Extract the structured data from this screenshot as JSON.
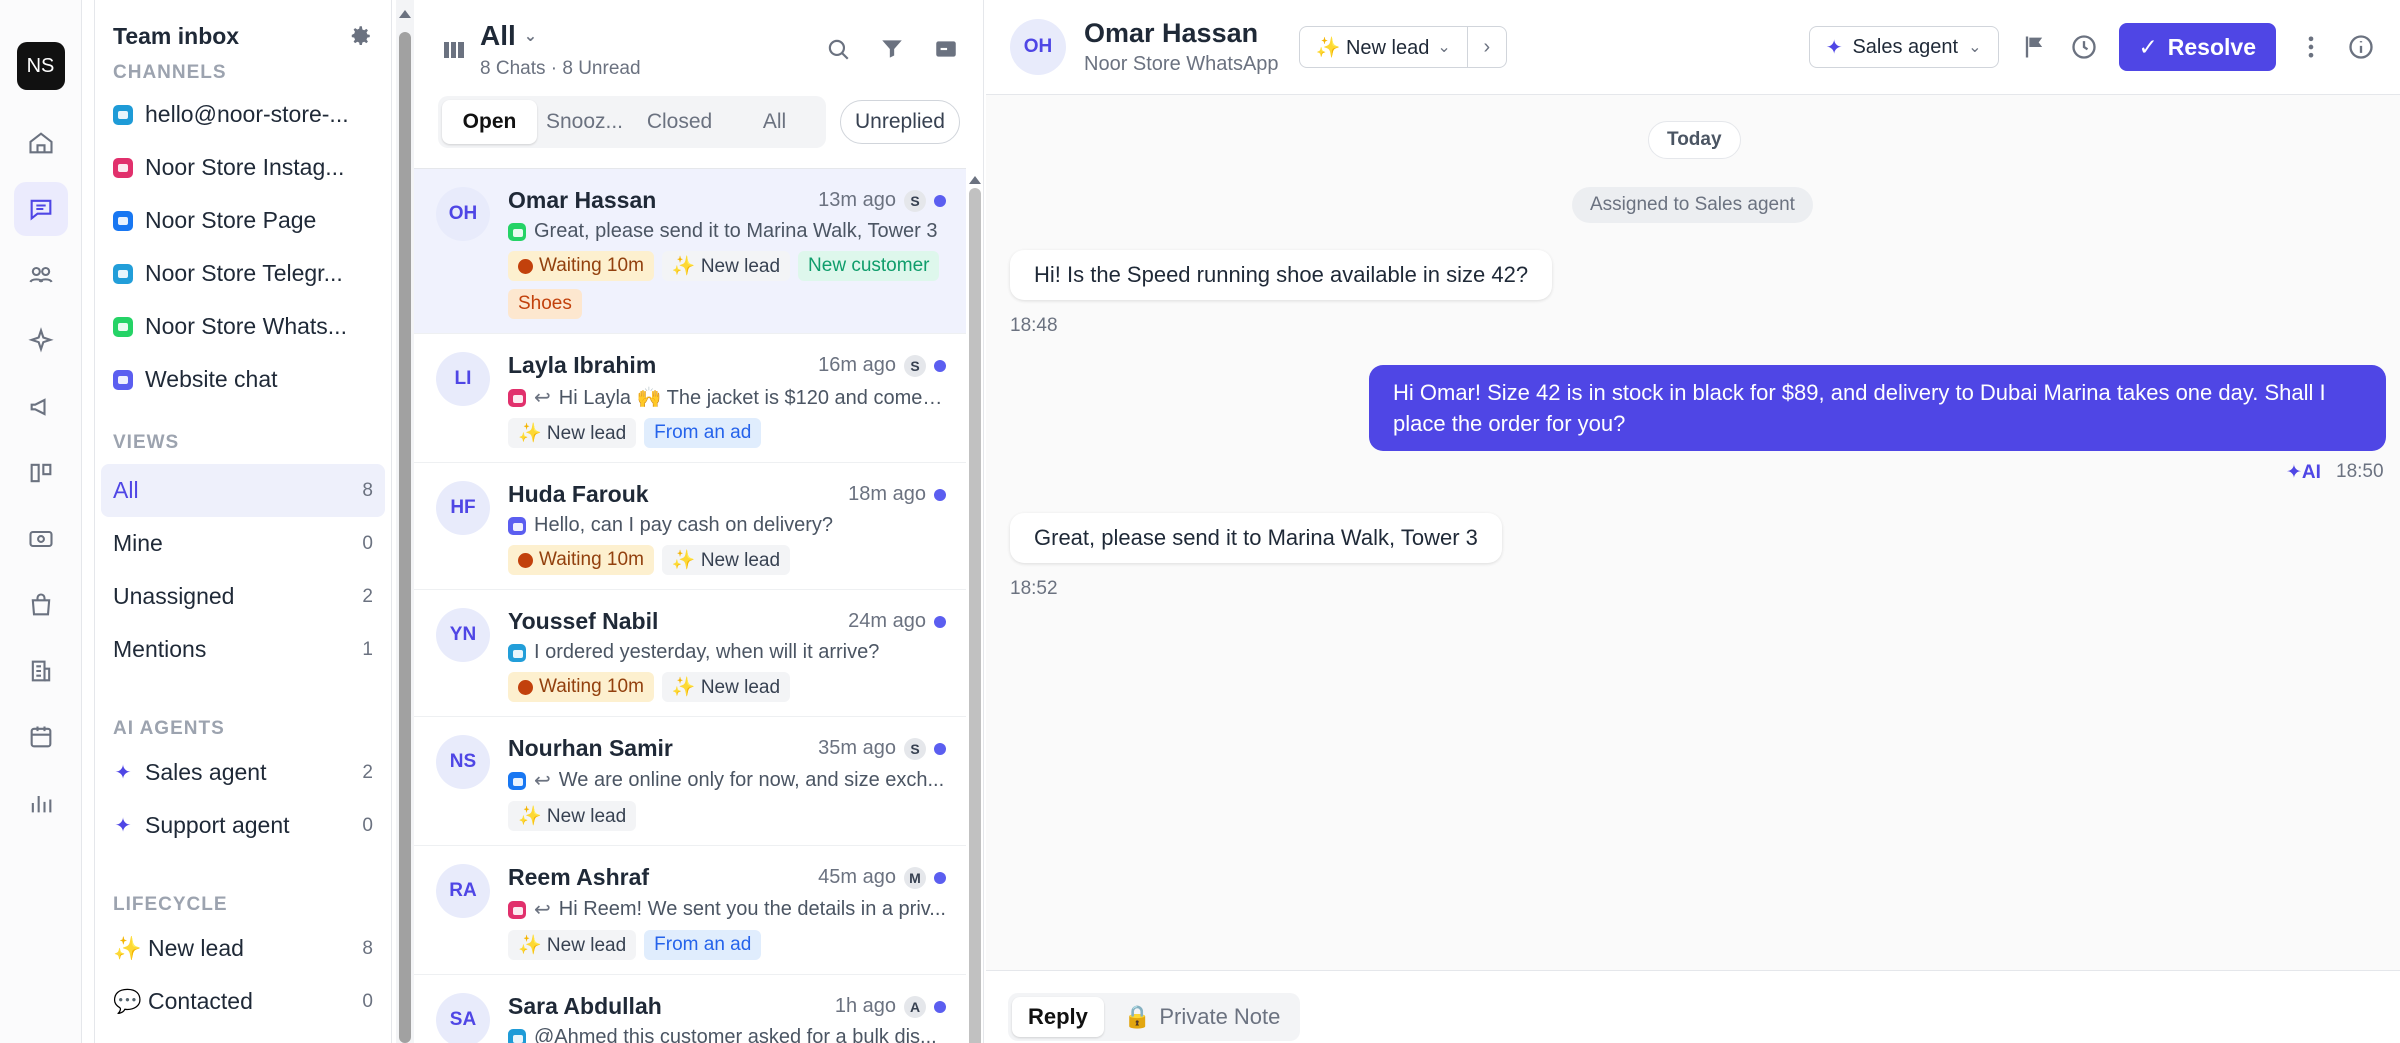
{
  "workspace": {
    "initials": "NS"
  },
  "sidebar": {
    "title": "Team inbox",
    "channels_heading": "CHANNELS",
    "channels": [
      {
        "label": "hello@noor-store-...",
        "icon": "email-icon",
        "color": "#1e9bd7"
      },
      {
        "label": "Noor Store Instag...",
        "icon": "instagram-icon",
        "color": "#e1306c"
      },
      {
        "label": "Noor Store Page",
        "icon": "facebook-icon",
        "color": "#1877f2"
      },
      {
        "label": "Noor Store Telegr...",
        "icon": "telegram-icon",
        "color": "#229ed9"
      },
      {
        "label": "Noor Store Whats...",
        "icon": "whatsapp-icon",
        "color": "#25d366"
      },
      {
        "label": "Website chat",
        "icon": "chat-icon",
        "color": "#5b5ef0"
      }
    ],
    "views_heading": "VIEWS",
    "views": [
      {
        "label": "All",
        "count": "8"
      },
      {
        "label": "Mine",
        "count": "0"
      },
      {
        "label": "Unassigned",
        "count": "2"
      },
      {
        "label": "Mentions",
        "count": "1"
      }
    ],
    "agents_heading": "AI AGENTS",
    "agents": [
      {
        "label": "Sales agent",
        "count": "2"
      },
      {
        "label": "Support agent",
        "count": "0"
      }
    ],
    "lifecycle_heading": "LIFECYCLE",
    "lifecycle": [
      {
        "label": "✨ New lead",
        "count": "8"
      },
      {
        "label": "💬 Contacted",
        "count": "0"
      }
    ]
  },
  "list": {
    "title": "All",
    "subtitle": "8 Chats · 8 Unread",
    "tabs": [
      "Open",
      "Snooz...",
      "Closed",
      "All"
    ],
    "unreplied": "Unreplied",
    "conversations": [
      {
        "initials": "OH",
        "name": "Omar Hassan",
        "time": "13m ago",
        "assignee": "S",
        "channel_color": "#25d366",
        "reply": "",
        "preview": "Great, please send it to Marina Walk, Tower 3",
        "tags": [
          "Waiting 10m",
          "✨ New lead",
          "New customer",
          "Shoes"
        ]
      },
      {
        "initials": "LI",
        "name": "Layla Ibrahim",
        "time": "16m ago",
        "assignee": "S",
        "channel_color": "#e1306c",
        "reply": "↩",
        "preview": "Hi Layla 🙌 The jacket is $120 and comes...",
        "tags": [
          "✨ New lead",
          "From an ad"
        ]
      },
      {
        "initials": "HF",
        "name": "Huda Farouk",
        "time": "18m ago",
        "assignee": "",
        "channel_color": "#5b5ef0",
        "reply": "",
        "preview": "Hello, can I pay cash on delivery?",
        "tags": [
          "Waiting 10m",
          "✨ New lead"
        ]
      },
      {
        "initials": "YN",
        "name": "Youssef Nabil",
        "time": "24m ago",
        "assignee": "",
        "channel_color": "#229ed9",
        "reply": "",
        "preview": "I ordered yesterday, when will it arrive?",
        "tags": [
          "Waiting 10m",
          "✨ New lead"
        ]
      },
      {
        "initials": "NS",
        "name": "Nourhan Samir",
        "time": "35m ago",
        "assignee": "S",
        "channel_color": "#1877f2",
        "reply": "↩",
        "preview": "We are online only for now, and size exch...",
        "tags": [
          "✨ New lead"
        ]
      },
      {
        "initials": "RA",
        "name": "Reem Ashraf",
        "time": "45m ago",
        "assignee": "M",
        "channel_color": "#e1306c",
        "reply": "↩",
        "preview": "Hi Reem! We sent you the details in a priv...",
        "tags": [
          "✨ New lead",
          "From an ad"
        ]
      },
      {
        "initials": "SA",
        "name": "Sara Abdullah",
        "time": "1h ago",
        "assignee": "A",
        "channel_color": "#1e9bd7",
        "reply": "",
        "preview": "@Ahmed this customer asked for a bulk dis...",
        "tags": []
      }
    ]
  },
  "conversation": {
    "initials": "OH",
    "name": "Omar Hassan",
    "channel": "Noor Store WhatsApp",
    "stage": "✨ New lead",
    "agent": "Sales agent",
    "resolve": "Resolve",
    "date_pill": "Today",
    "assigned_note": "Assigned to Sales agent",
    "messages": [
      {
        "dir": "in",
        "text": "Hi! Is the Speed running shoe available in size 42?",
        "time": "18:48"
      },
      {
        "dir": "out",
        "text": "Hi Omar! Size 42 is in stock in black for $89, and delivery to Dubai Marina takes one day. Shall I place the order for you?",
        "badge": "AI",
        "time": "18:50"
      },
      {
        "dir": "in",
        "text": "Great, please send it to Marina Walk, Tower 3",
        "time": "18:52"
      }
    ],
    "composer_tabs": [
      "Reply",
      "Private Note"
    ]
  }
}
